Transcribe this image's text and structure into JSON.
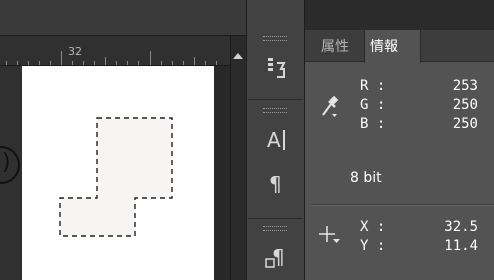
{
  "ruler": {
    "top_label": "32"
  },
  "marker": {
    "text": ")"
  },
  "strip": {
    "collapse_label": "◂◂"
  },
  "panel": {
    "tabs": [
      {
        "label": "属性"
      },
      {
        "label": "情報"
      }
    ],
    "color": {
      "r_label": "R :",
      "r_value": "253",
      "g_label": "G :",
      "g_value": "250",
      "b_label": "B :",
      "b_value": "250"
    },
    "bits_text": "8 bit",
    "coords": {
      "x_label": "X :",
      "x_value": "32.5",
      "y_label": "Y :",
      "y_value": "11.4"
    }
  },
  "selection": {
    "fill": "#f6f5f4",
    "stroke": "#222222"
  },
  "icons": [
    "eyedropper-icon",
    "crosshair-icon",
    "histogram-icon",
    "character-icon",
    "paragraph-icon",
    "paragraph-style-icon"
  ]
}
